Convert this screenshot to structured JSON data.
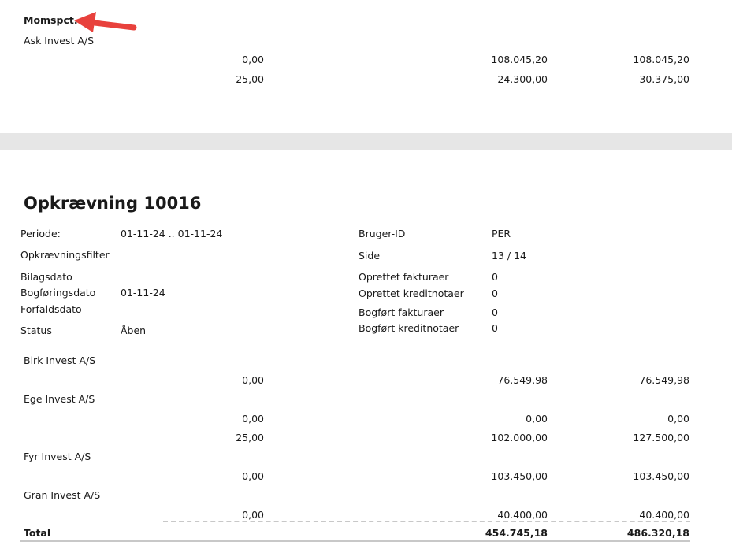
{
  "top": {
    "vat_header": "Momspct.",
    "customer": "Ask Invest A/S",
    "rows": [
      {
        "vat": "0,00",
        "amount": "108.045,20",
        "total": "108.045,20"
      },
      {
        "vat": "25,00",
        "amount": "24.300,00",
        "total": "30.375,00"
      }
    ]
  },
  "doc": {
    "title": "Opkrævning 10016",
    "left": {
      "periode_label": "Periode:",
      "periode_value": "01-11-24 .. 01-11-24",
      "filter_label": "Opkrævningsfilter",
      "bilagsdato_label": "Bilagsdato",
      "bogforingsdato_label": "Bogføringsdato",
      "bogforingsdato_value": "01-11-24",
      "forfaldsdato_label": "Forfaldsdato",
      "status_label": "Status",
      "status_value": "Åben"
    },
    "right": {
      "bruger_label": "Bruger-ID",
      "bruger_value": "PER",
      "side_label": "Side",
      "side_value": "13 / 14",
      "opr_fakt_label": "Oprettet fakturaer",
      "opr_fakt_value": "0",
      "opr_kred_label": "Oprettet kreditnotaer",
      "opr_kred_value": "0",
      "bog_fakt_label": "Bogført fakturaer",
      "bog_fakt_value": "0",
      "bog_kred_label": "Bogført kreditnotaer",
      "bog_kred_value": "0"
    },
    "customers": [
      {
        "name": "Birk Invest A/S",
        "rows": [
          {
            "vat": "0,00",
            "amount": "76.549,98",
            "total": "76.549,98"
          }
        ]
      },
      {
        "name": "Ege Invest A/S",
        "rows": [
          {
            "vat": "0,00",
            "amount": "0,00",
            "total": "0,00"
          },
          {
            "vat": "25,00",
            "amount": "102.000,00",
            "total": "127.500,00"
          }
        ]
      },
      {
        "name": "Fyr Invest A/S",
        "rows": [
          {
            "vat": "0,00",
            "amount": "103.450,00",
            "total": "103.450,00"
          }
        ]
      },
      {
        "name": "Gran Invest A/S",
        "rows": [
          {
            "vat": "0,00",
            "amount": "40.400,00",
            "total": "40.400,00"
          }
        ]
      }
    ],
    "total": {
      "label": "Total",
      "amount": "454.745,18",
      "total": "486.320,18"
    }
  },
  "colors": {
    "arrow": "#e8413c",
    "separator": "#e6e6e6"
  },
  "icons": {
    "annotation": "red-arrow-icon"
  }
}
